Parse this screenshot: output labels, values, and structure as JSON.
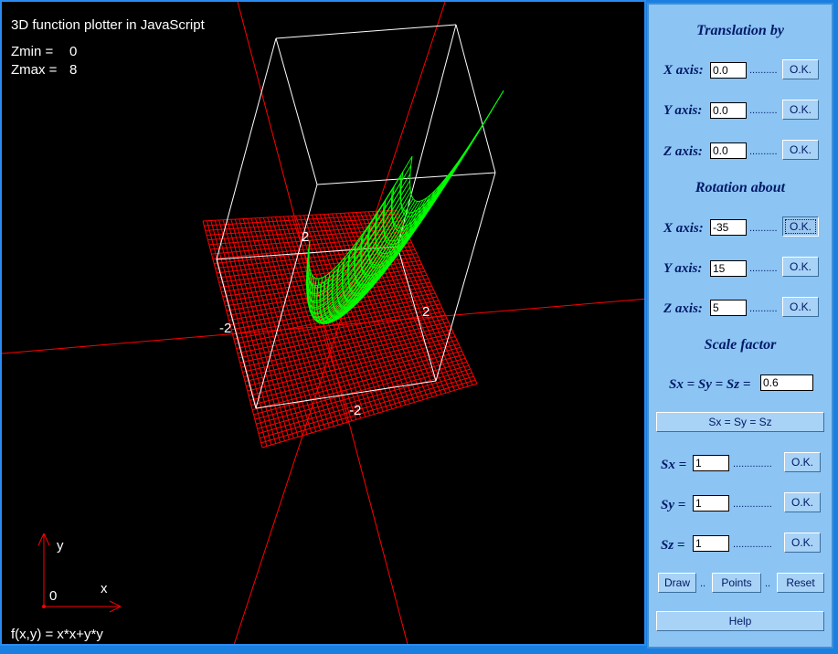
{
  "plot": {
    "title": "3D function plotter in JavaScript",
    "zmin_label": "Zmin =",
    "zmin_value": "0",
    "zmax_label": "Zmax =",
    "zmax_value": "8",
    "function_label": "f(x,y) = x*x+y*y",
    "axis_y_label": "y",
    "axis_x_label": "x",
    "origin_label": "0",
    "tick_z": "2",
    "tick_x_left": "-2",
    "tick_y_right": "2",
    "tick_bottom": "-2",
    "colors": {
      "surface": "#00ff00",
      "grid": "#ff0000",
      "box": "#ffffff",
      "axes": "#ff0000",
      "background": "#000000"
    }
  },
  "panel": {
    "translation_header": "Translation by",
    "rotation_header": "Rotation about",
    "scale_header": "Scale factor",
    "x_axis_label": "X axis:",
    "y_axis_label": "Y axis:",
    "z_axis_label": "Z axis:",
    "translation": {
      "x": "0.0",
      "y": "0.0",
      "z": "0.0"
    },
    "rotation": {
      "x": "-35",
      "y": "15",
      "z": "5"
    },
    "ok_label": "O.K.",
    "dots_short": "..........",
    "dots_long": "..............",
    "sxyz_label": "Sx = Sy = Sz =",
    "sxyz_value": "0.6",
    "sxyz_button": "Sx = Sy = Sz",
    "sx_label": "Sx =",
    "sy_label": "Sy =",
    "sz_label": "Sz =",
    "sx_value": "1",
    "sy_value": "1",
    "sz_value": "1",
    "draw_label": "Draw",
    "points_label": "Points",
    "reset_label": "Reset",
    "help_label": "Help",
    "sep": ".."
  }
}
